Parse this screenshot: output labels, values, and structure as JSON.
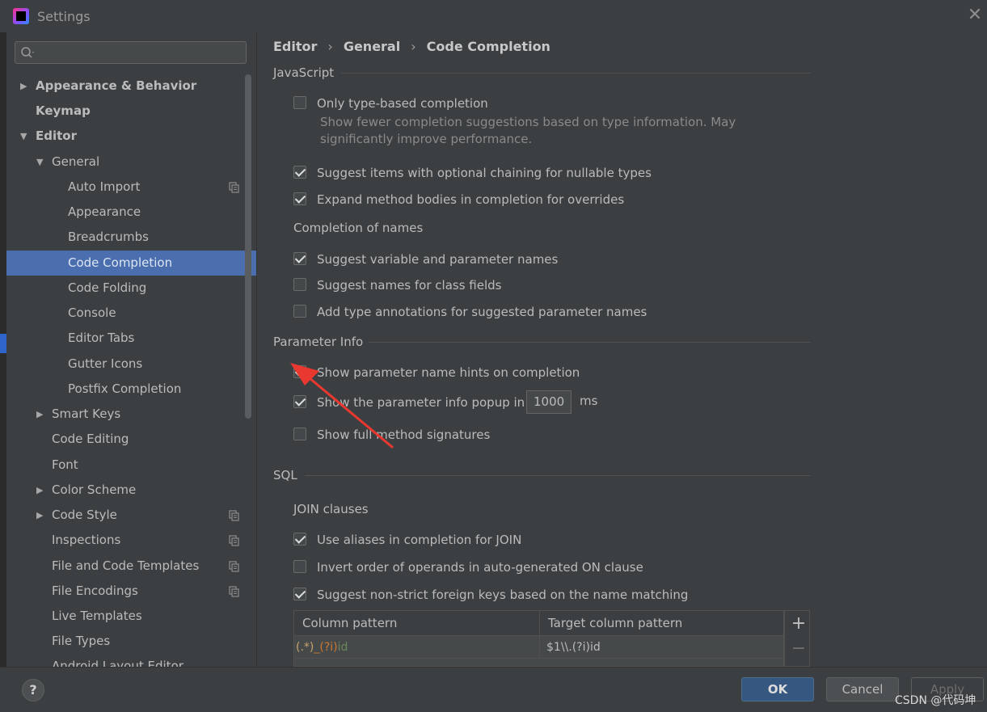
{
  "window": {
    "title": "Settings",
    "close_glyph": "✕"
  },
  "search": {
    "placeholder": ""
  },
  "sidebar": {
    "items": [
      {
        "label": "Appearance & Behavior",
        "expander": "collapsed"
      },
      {
        "label": "Keymap"
      },
      {
        "label": "Editor",
        "expander": "expanded"
      },
      {
        "label": "General",
        "expander": "expanded"
      },
      {
        "label": "Auto Import",
        "has_copy_icon": true
      },
      {
        "label": "Appearance"
      },
      {
        "label": "Breadcrumbs"
      },
      {
        "label": "Code Completion",
        "selected": true
      },
      {
        "label": "Code Folding"
      },
      {
        "label": "Console"
      },
      {
        "label": "Editor Tabs"
      },
      {
        "label": "Gutter Icons"
      },
      {
        "label": "Postfix Completion"
      },
      {
        "label": "Smart Keys",
        "expander": "collapsed"
      },
      {
        "label": "Code Editing"
      },
      {
        "label": "Font"
      },
      {
        "label": "Color Scheme",
        "expander": "collapsed"
      },
      {
        "label": "Code Style",
        "expander": "collapsed",
        "has_copy_icon": true
      },
      {
        "label": "Inspections",
        "has_copy_icon": true
      },
      {
        "label": "File and Code Templates",
        "has_copy_icon": true
      },
      {
        "label": "File Encodings",
        "has_copy_icon": true
      },
      {
        "label": "Live Templates"
      },
      {
        "label": "File Types"
      },
      {
        "label": "Android Layout Editor"
      }
    ]
  },
  "breadcrumb": [
    "Editor",
    "General",
    "Code Completion"
  ],
  "breadcrumb_sep": "›",
  "javascript": {
    "title": "JavaScript",
    "only_type_based": {
      "label": "Only type-based completion",
      "checked": false
    },
    "only_type_based_hint_1": "Show fewer completion suggestions based on type information. May",
    "only_type_based_hint_2": "significantly improve performance.",
    "optional_chaining": {
      "label": "Suggest items with optional chaining for nullable types",
      "checked": true
    },
    "expand_method_bodies": {
      "label": "Expand method bodies in completion for overrides",
      "checked": true
    },
    "names_title": "Completion of names",
    "suggest_var_names": {
      "label": "Suggest variable and parameter names",
      "checked": true
    },
    "suggest_class_fields": {
      "label": "Suggest names for class fields",
      "checked": false
    },
    "add_type_annotations": {
      "label": "Add type annotations for suggested parameter names",
      "checked": false
    }
  },
  "parameter_info": {
    "title": "Parameter Info",
    "show_name_hints": {
      "label": "Show parameter name hints on completion",
      "checked": true
    },
    "show_popup": {
      "label": "Show the parameter info popup in",
      "checked": true
    },
    "popup_delay_value": "1000",
    "popup_delay_unit": "ms",
    "show_full_signatures": {
      "label": "Show full method signatures",
      "checked": false
    }
  },
  "sql": {
    "title": "SQL",
    "join_title": "JOIN clauses",
    "use_aliases": {
      "label": "Use aliases in completion for JOIN",
      "checked": true
    },
    "invert_order": {
      "label": "Invert order of operands in auto-generated ON clause",
      "checked": false
    },
    "suggest_foreign_keys": {
      "label": "Suggest non-strict foreign keys based on the name matching",
      "checked": true
    },
    "table": {
      "headers": [
        "Column pattern",
        "Target column pattern"
      ],
      "row_column_pattern": [
        "(.*)",
        "_(?i)",
        "id"
      ],
      "row_target_pattern": "$1\\\\.(?i)id",
      "add_glyph": "+",
      "remove_glyph": "−"
    }
  },
  "buttons": {
    "help": "?",
    "ok": "OK",
    "cancel": "Cancel",
    "apply": "Apply"
  },
  "watermark": "CSDN @代码坤",
  "colors": {
    "selection": "#4b6eaf",
    "ok_button": "#365880",
    "annotation_arrow": "#e8382f"
  }
}
